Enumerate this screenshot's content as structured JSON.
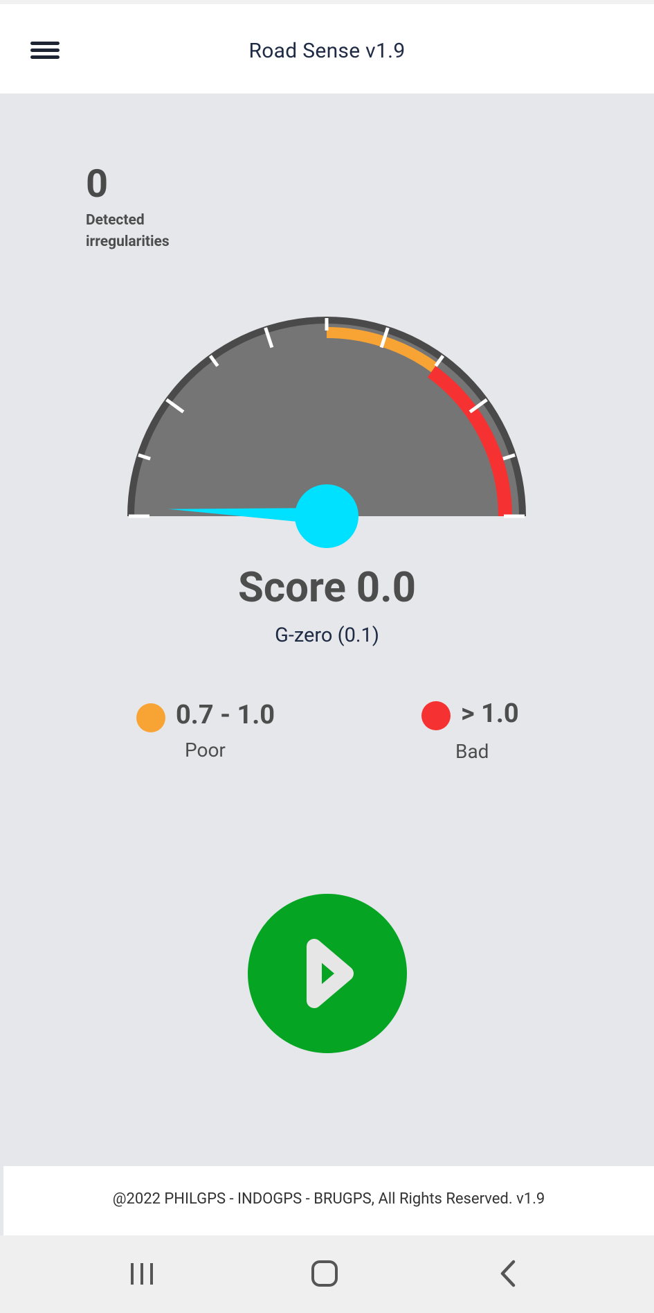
{
  "header": {
    "title": "Road Sense v1.9",
    "menu_icon": "hamburger-menu-icon"
  },
  "counter": {
    "value": "0",
    "label": "Detected irregularities"
  },
  "gauge": {
    "min": 0,
    "max": 2.0,
    "value": 0.0,
    "major_ticks": 6,
    "minor_ticks_per_major": 2,
    "poor_range": [
      1.0,
      1.4
    ],
    "bad_range": [
      1.4,
      2.0
    ],
    "colors": {
      "face": "#757575",
      "rim": "#4a4a4a",
      "ticks": "#ffffff",
      "poor": "#f8a434",
      "bad": "#f53231",
      "needle": "#00e0ff"
    }
  },
  "score": {
    "text": "Score 0.0",
    "gzero": "G-zero (0.1)"
  },
  "legend": {
    "poor": {
      "range": "0.7 - 1.0",
      "label": "Poor",
      "color": "#f8a434"
    },
    "bad": {
      "range": "> 1.0",
      "label": "Bad",
      "color": "#f53231"
    }
  },
  "controls": {
    "play_icon": "play-icon",
    "play_color": "#05a523"
  },
  "footer": {
    "text": "@2022 PHILGPS - INDOGPS - BRUGPS, All Rights Reserved. v1.9"
  },
  "system_nav": {
    "recent": "recent-apps-icon",
    "home": "home-icon",
    "back": "back-icon"
  }
}
